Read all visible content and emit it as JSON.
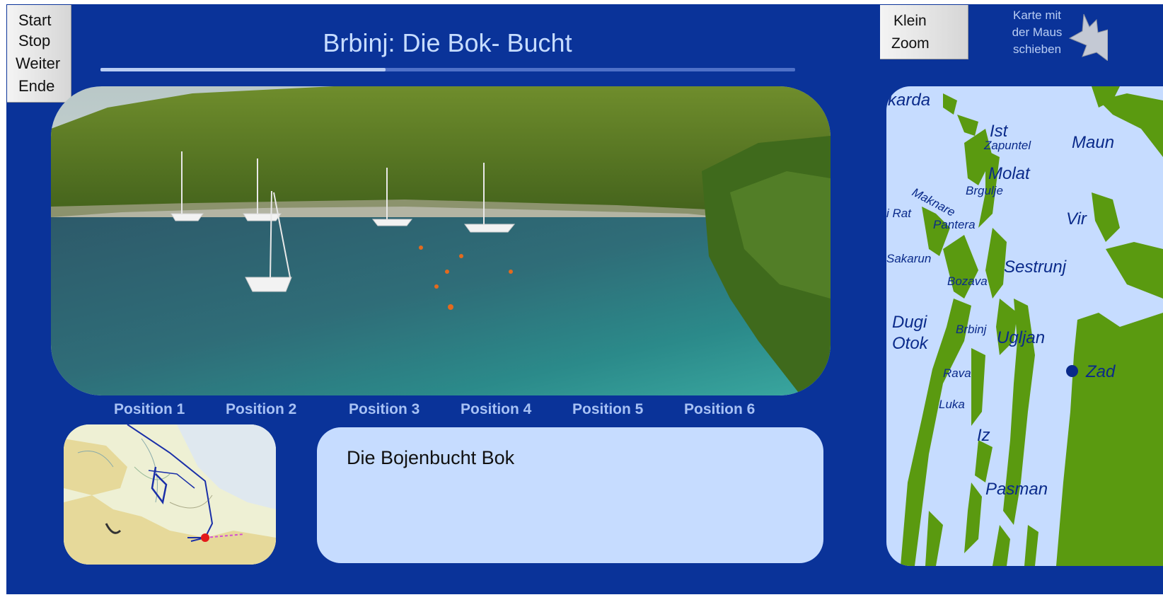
{
  "controls": {
    "start": "Start",
    "stop": "Stop",
    "weiter": "Weiter",
    "ende": "Ende"
  },
  "header": {
    "title": "Brbinj: Die Bok- Bucht",
    "progress_fraction": 0.41
  },
  "positions": [
    "Position 1",
    "Position 2",
    "Position 3",
    "Position 4",
    "Position 5",
    "Position 6"
  ],
  "description": {
    "text": "Die Bojenbucht Bok"
  },
  "zoom": {
    "line1": "Klein",
    "line2": "Zoom"
  },
  "hint": {
    "line1": "Karte mit",
    "line2": "der Maus",
    "line3": "schieben",
    "icon": "hand-icon"
  },
  "map_labels": {
    "skarda": "karda",
    "ist": "Ist",
    "zapuntel": "Zapuntel",
    "maun": "Maun",
    "molat": "Molat",
    "maknare": "Maknare",
    "brgulje": "Brgulje",
    "rat": "i Rat",
    "pantera": "Pantera",
    "vir": "Vir",
    "sakarun": "Sakarun",
    "sestrunj": "Sestrunj",
    "bozava": "Bozava",
    "dugi": "Dugi",
    "otok": "Otok",
    "brbinj": "Brbinj",
    "ugljan": "Ugljan",
    "zadar": "Zad",
    "rava": "Rava",
    "luka": "Luka",
    "iz": "Iz",
    "pasman": "Pasman"
  },
  "colors": {
    "background": "#0a3399",
    "panel": "#c6dcff",
    "land": "#5a9a10",
    "tab_text": "#a7c1f4"
  }
}
